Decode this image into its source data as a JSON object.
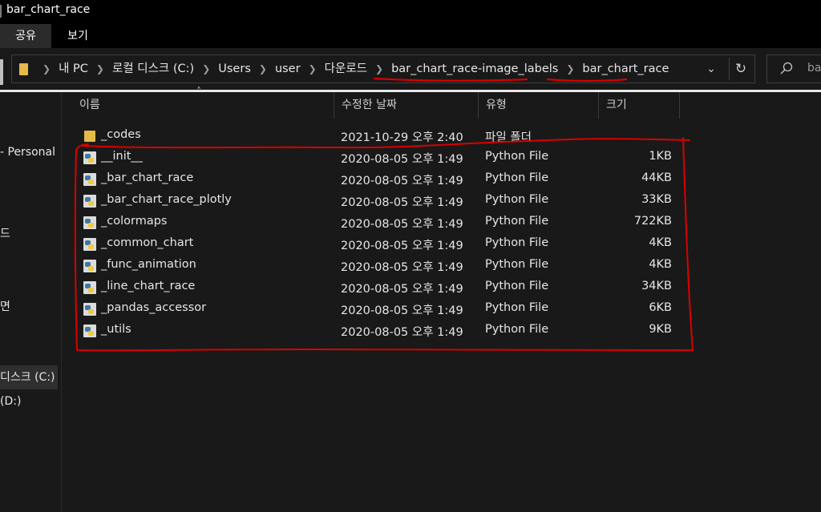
{
  "window": {
    "title": "bar_chart_race"
  },
  "ribbon": {
    "tabs": [
      {
        "label": "공유",
        "active": true
      },
      {
        "label": "보기",
        "active": false
      }
    ]
  },
  "address": {
    "crumbs": [
      "내 PC",
      "로컬 디스크 (C:)",
      "Users",
      "user",
      "다운로드",
      "bar_chart_race-image_labels",
      "bar_chart_race"
    ],
    "separator_icon": "chevron-right-icon",
    "dropdown_icon": "chevron-down-icon",
    "refresh_icon": "refresh-icon"
  },
  "search": {
    "placeholder": "ba",
    "icon": "search-icon"
  },
  "nav": {
    "items": [
      {
        "label": "- Personal",
        "selected": false
      },
      {
        "label": "드",
        "selected": false
      },
      {
        "label": "면",
        "selected": false
      },
      {
        "label": "디스크 (C:)",
        "selected": true
      },
      {
        "label": "(D:)",
        "selected": false
      }
    ]
  },
  "columns": {
    "name": "이름",
    "date": "수정한 날짜",
    "type": "유형",
    "size": "크기"
  },
  "files": [
    {
      "name": "_codes",
      "date": "2021-10-29 오후 2:40",
      "type": "파일 폴더",
      "size": "",
      "icon": "folder-icon"
    },
    {
      "name": "__init__",
      "date": "2020-08-05 오후 1:49",
      "type": "Python File",
      "size": "1KB",
      "icon": "python-file-icon"
    },
    {
      "name": "_bar_chart_race",
      "date": "2020-08-05 오후 1:49",
      "type": "Python File",
      "size": "44KB",
      "icon": "python-file-icon"
    },
    {
      "name": "_bar_chart_race_plotly",
      "date": "2020-08-05 오후 1:49",
      "type": "Python File",
      "size": "33KB",
      "icon": "python-file-icon"
    },
    {
      "name": "_colormaps",
      "date": "2020-08-05 오후 1:49",
      "type": "Python File",
      "size": "722KB",
      "icon": "python-file-icon"
    },
    {
      "name": "_common_chart",
      "date": "2020-08-05 오후 1:49",
      "type": "Python File",
      "size": "4KB",
      "icon": "python-file-icon"
    },
    {
      "name": "_func_animation",
      "date": "2020-08-05 오후 1:49",
      "type": "Python File",
      "size": "4KB",
      "icon": "python-file-icon"
    },
    {
      "name": "_line_chart_race",
      "date": "2020-08-05 오후 1:49",
      "type": "Python File",
      "size": "34KB",
      "icon": "python-file-icon"
    },
    {
      "name": "_pandas_accessor",
      "date": "2020-08-05 오후 1:49",
      "type": "Python File",
      "size": "6KB",
      "icon": "python-file-icon"
    },
    {
      "name": "_utils",
      "date": "2020-08-05 오후 1:49",
      "type": "Python File",
      "size": "9KB",
      "icon": "python-file-icon"
    }
  ],
  "colors": {
    "background": "#191919",
    "titlebar": "#000000",
    "text": "#e6e6e6",
    "annotation": "#d90000",
    "folder": "#e5b94a"
  }
}
